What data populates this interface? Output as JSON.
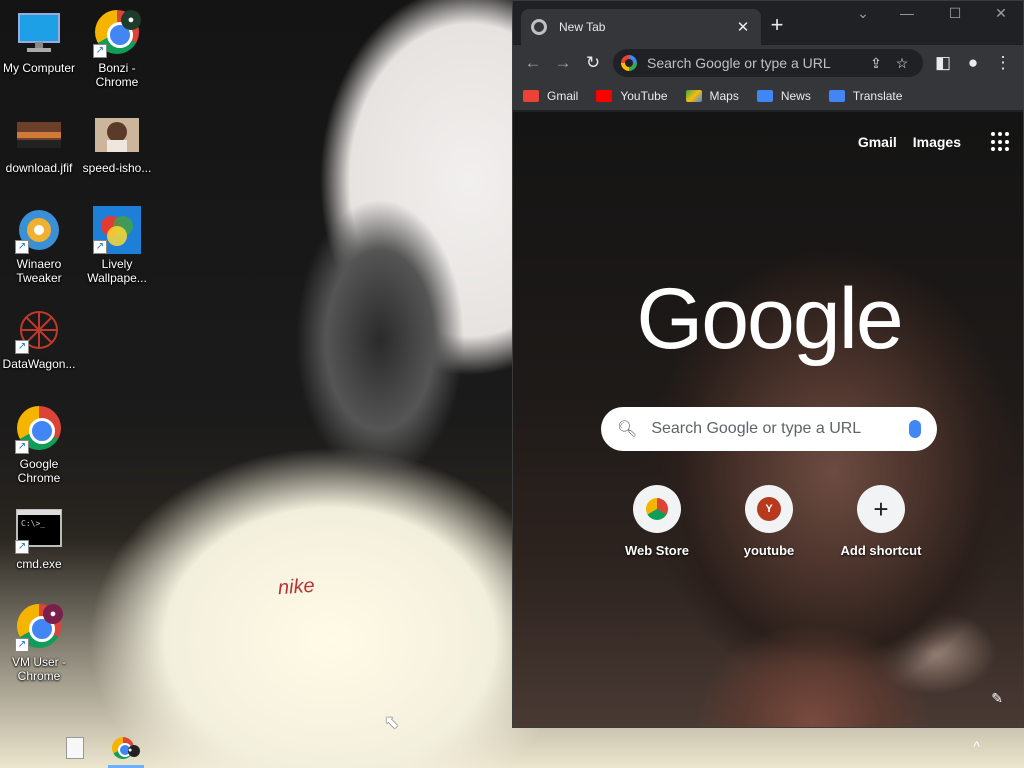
{
  "desktop": {
    "icons": [
      {
        "label": "My Computer",
        "icon": "monitor-icon"
      },
      {
        "label": "Bonzi -\nChrome",
        "icon": "chrome-icon"
      },
      {
        "label": "download.jfif",
        "icon": "image-file-icon"
      },
      {
        "label": "speed-isho...",
        "icon": "image-file-icon"
      },
      {
        "label": "Winaero\nTweaker",
        "icon": "winaero-icon"
      },
      {
        "label": "Lively\nWallpape...",
        "icon": "lively-icon"
      },
      {
        "label": "DataWagon...",
        "icon": "datawagon-icon"
      },
      {
        "label": "Google\nChrome",
        "icon": "chrome-icon"
      },
      {
        "label": "cmd.exe",
        "icon": "terminal-icon"
      },
      {
        "label": "VM User -\nChrome",
        "icon": "chrome-icon"
      }
    ],
    "wallpaper_text": "nike"
  },
  "browser": {
    "tab_title": "New Tab",
    "omnibox_placeholder": "Search Google or type a URL",
    "bookmarks": [
      {
        "label": "Gmail",
        "color": "#ea4335"
      },
      {
        "label": "YouTube",
        "color": "#ff0000"
      },
      {
        "label": "Maps",
        "color": "#34a853"
      },
      {
        "label": "News",
        "color": "#4285f4"
      },
      {
        "label": "Translate",
        "color": "#4285f4"
      }
    ],
    "ntp": {
      "links": [
        "Gmail",
        "Images"
      ],
      "logo": "Google",
      "search_placeholder": "Search Google or type a URL",
      "shortcuts": [
        {
          "label": "Web Store",
          "letter": ""
        },
        {
          "label": "youtube",
          "letter": "Y"
        },
        {
          "label": "Add shortcut",
          "letter": "+"
        }
      ]
    }
  }
}
